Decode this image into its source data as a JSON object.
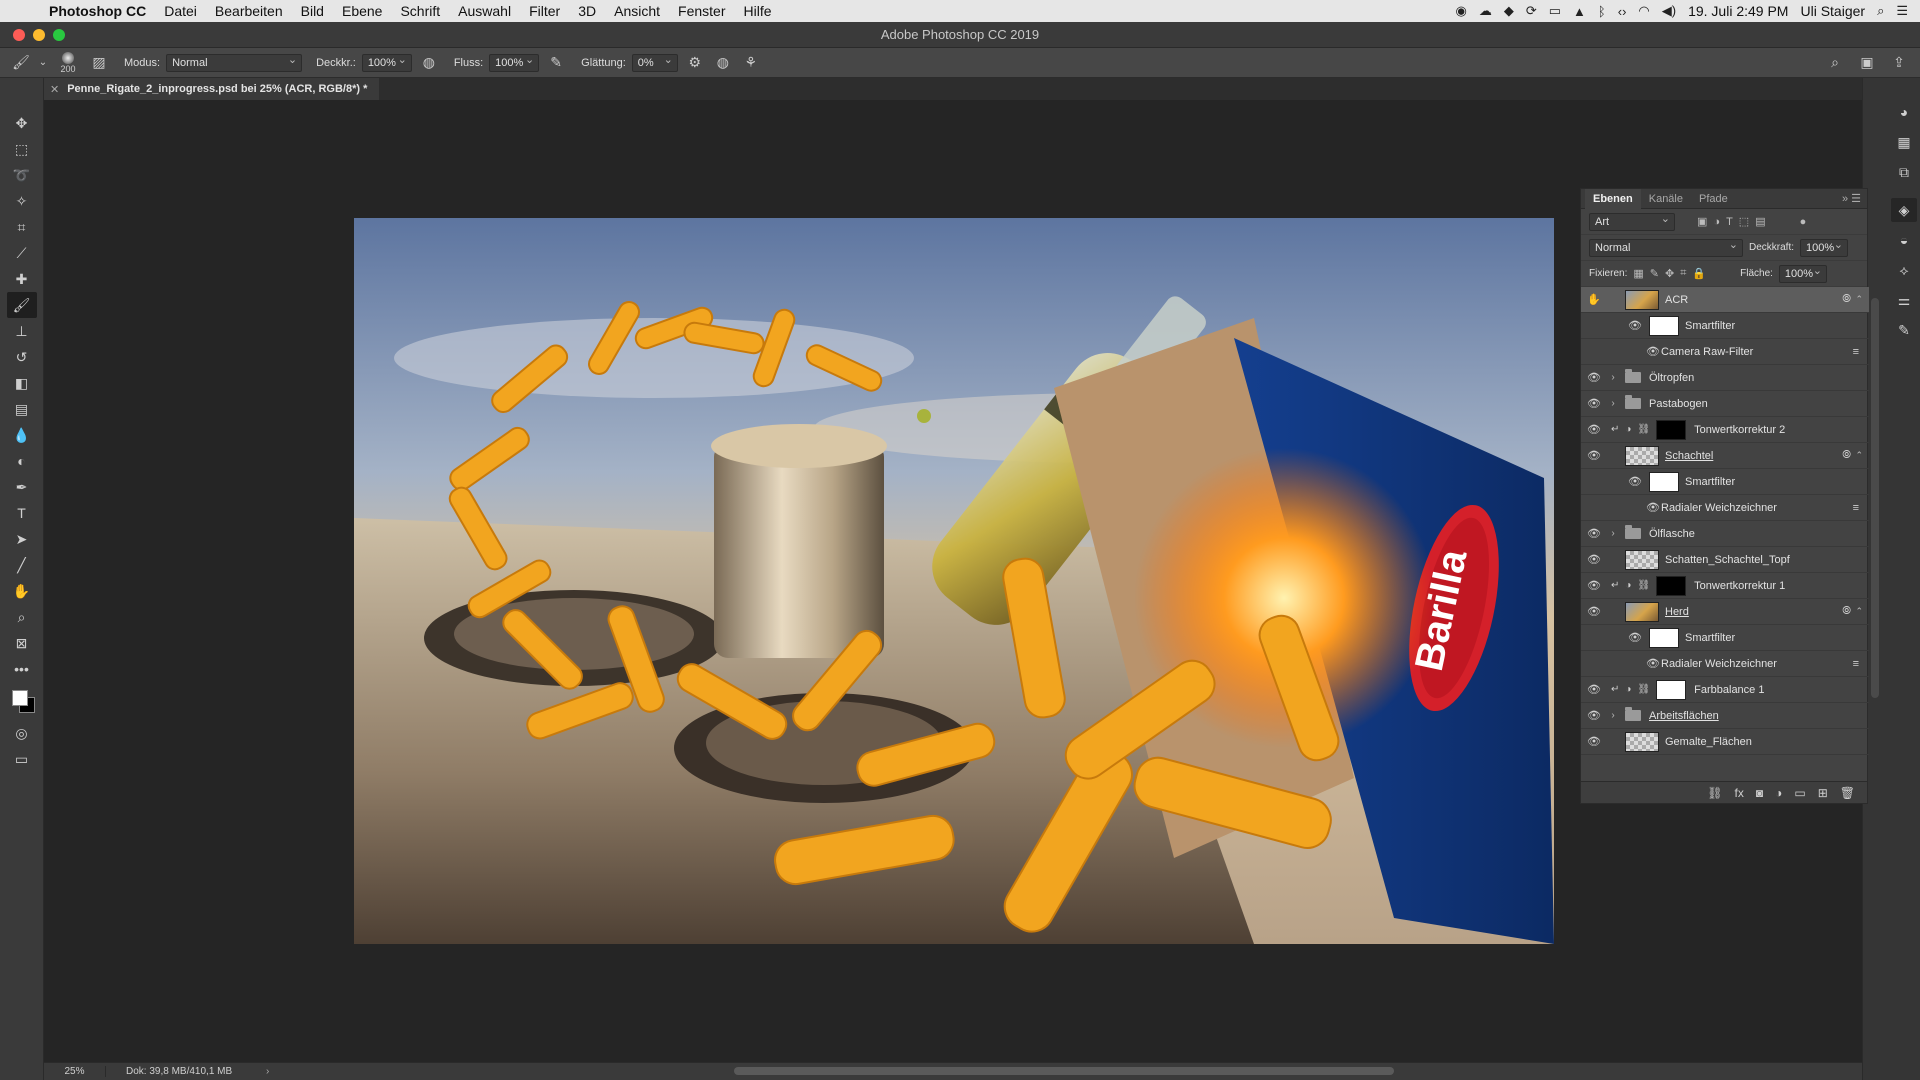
{
  "menubar": {
    "items": [
      "Photoshop CC",
      "Datei",
      "Bearbeiten",
      "Bild",
      "Ebene",
      "Schrift",
      "Auswahl",
      "Filter",
      "3D",
      "Ansicht",
      "Fenster",
      "Hilfe"
    ],
    "datetime": "19. Juli  2:49 PM",
    "user": "Uli Staiger"
  },
  "window": {
    "title": "Adobe Photoshop CC 2019"
  },
  "options": {
    "brush_size": "200",
    "mode_label": "Modus:",
    "mode_value": "Normal",
    "opacity_label": "Deckkr.:",
    "opacity_value": "100%",
    "flow_label": "Fluss:",
    "flow_value": "100%",
    "smoothing_label": "Glättung:",
    "smoothing_value": "0%"
  },
  "document": {
    "tab_title": "Penne_Rigate_2_inprogress.psd bei 25% (ACR, RGB/8*) *"
  },
  "status": {
    "zoom": "25%",
    "doc_size": "Dok: 39,8 MB/410,1 MB"
  },
  "layers_panel": {
    "tabs": [
      "Ebenen",
      "Kanäle",
      "Pfade"
    ],
    "filter_kind": "Art",
    "blend_mode": "Normal",
    "opacity_label": "Deckkraft:",
    "opacity_value": "100%",
    "lock_label": "Fixieren:",
    "fill_label": "Fläche:",
    "fill_value": "100%",
    "layers": [
      {
        "name": "ACR"
      },
      {
        "name": "Smartfilter"
      },
      {
        "name": "Camera Raw-Filter"
      },
      {
        "name": "Öltropfen"
      },
      {
        "name": "Pastabogen"
      },
      {
        "name": "Tonwertkorrektur 2"
      },
      {
        "name": "Schachtel"
      },
      {
        "name": "Smartfilter"
      },
      {
        "name": "Radialer Weichzeichner"
      },
      {
        "name": "Ölflasche"
      },
      {
        "name": "Schatten_Schachtel_Topf"
      },
      {
        "name": "Tonwertkorrektur 1"
      },
      {
        "name": "Herd"
      },
      {
        "name": "Smartfilter"
      },
      {
        "name": "Radialer Weichzeichner"
      },
      {
        "name": "Farbbalance 1"
      },
      {
        "name": "Arbeitsflächen"
      },
      {
        "name": "Gemalte_Flächen"
      }
    ]
  },
  "colors": {
    "accent_blue": "#1d5bbf",
    "box_red": "#d4202a",
    "pasta_yellow": "#f2a51f"
  }
}
